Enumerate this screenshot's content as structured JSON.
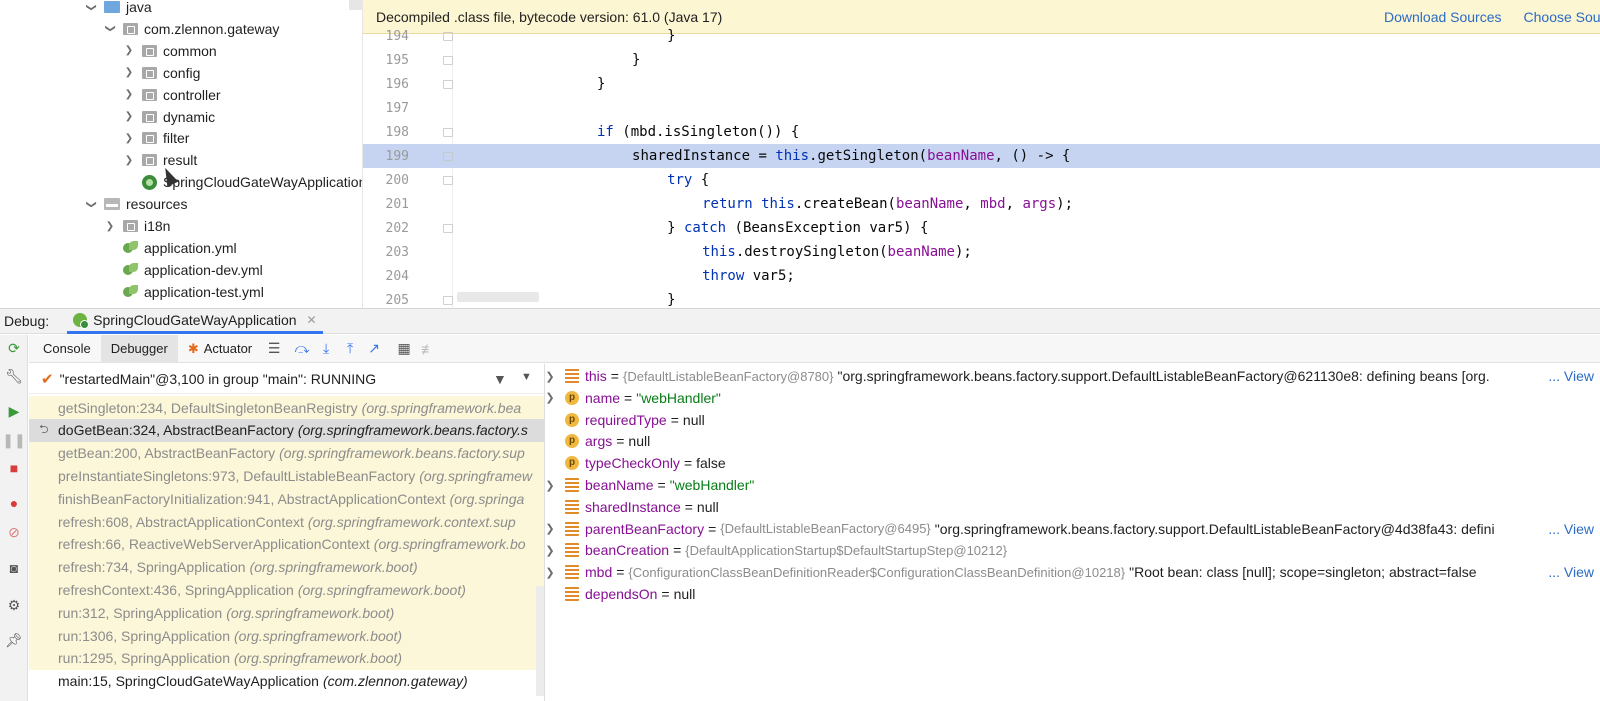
{
  "tree": {
    "items": [
      {
        "label": "java",
        "indent": 1,
        "chev": "down",
        "icon": "folder"
      },
      {
        "label": "com.zlennon.gateway",
        "indent": 2,
        "chev": "down",
        "icon": "package"
      },
      {
        "label": "common",
        "indent": 3,
        "chev": "right",
        "icon": "package"
      },
      {
        "label": "config",
        "indent": 3,
        "chev": "right",
        "icon": "package"
      },
      {
        "label": "controller",
        "indent": 3,
        "chev": "right",
        "icon": "package"
      },
      {
        "label": "dynamic",
        "indent": 3,
        "chev": "right",
        "icon": "package"
      },
      {
        "label": "filter",
        "indent": 3,
        "chev": "right",
        "icon": "package"
      },
      {
        "label": "result",
        "indent": 3,
        "chev": "right",
        "icon": "package"
      },
      {
        "label": "SpringCloudGateWayApplication",
        "indent": 3,
        "chev": "none",
        "icon": "class"
      },
      {
        "label": "resources",
        "indent": 1,
        "chev": "down",
        "icon": "resources"
      },
      {
        "label": "i18n",
        "indent": 2,
        "chev": "right",
        "icon": "package"
      },
      {
        "label": "application.yml",
        "indent": 2,
        "chev": "none",
        "icon": "yml"
      },
      {
        "label": "application-dev.yml",
        "indent": 2,
        "chev": "none",
        "icon": "yml"
      },
      {
        "label": "application-test.yml",
        "indent": 2,
        "chev": "none",
        "icon": "yml"
      }
    ]
  },
  "editor": {
    "banner": "Decompiled .class file, bytecode version: 61.0 (Java 17)",
    "download_sources": "Download Sources",
    "choose_sources": "Choose Sou",
    "lines": [
      {
        "num": "194",
        "indent": 8,
        "tokens": [
          [
            "t",
            "}"
          ]
        ],
        "fold": true
      },
      {
        "num": "195",
        "indent": 7,
        "tokens": [
          [
            "t",
            "}"
          ]
        ],
        "fold": true
      },
      {
        "num": "196",
        "indent": 6,
        "tokens": [
          [
            "t",
            "}"
          ]
        ],
        "fold": true
      },
      {
        "num": "197",
        "indent": 0,
        "tokens": [],
        "fold": false
      },
      {
        "num": "198",
        "indent": 6,
        "tokens": [
          [
            "k",
            "if"
          ],
          [
            "t",
            " (mbd.isSingleton()) {"
          ]
        ],
        "fold": true
      },
      {
        "num": "199",
        "indent": 7,
        "tokens": [
          [
            "t",
            "sharedInstance = "
          ],
          [
            "k",
            "this"
          ],
          [
            "t",
            ".getSingleton("
          ],
          [
            "p",
            "beanName"
          ],
          [
            "t",
            ", () -> {"
          ]
        ],
        "fold": true,
        "highlight": true
      },
      {
        "num": "200",
        "indent": 8,
        "tokens": [
          [
            "k",
            "try"
          ],
          [
            "t",
            " {"
          ]
        ],
        "fold": true
      },
      {
        "num": "201",
        "indent": 9,
        "tokens": [
          [
            "k",
            "return this"
          ],
          [
            "t",
            ".createBean("
          ],
          [
            "p",
            "beanName"
          ],
          [
            "t",
            ", "
          ],
          [
            "p",
            "mbd"
          ],
          [
            "t",
            ", "
          ],
          [
            "p",
            "args"
          ],
          [
            "t",
            ");"
          ]
        ],
        "fold": false
      },
      {
        "num": "202",
        "indent": 8,
        "tokens": [
          [
            "t",
            "} "
          ],
          [
            "k",
            "catch"
          ],
          [
            "t",
            " (BeansException var5) {"
          ]
        ],
        "fold": true
      },
      {
        "num": "203",
        "indent": 9,
        "tokens": [
          [
            "k",
            "this"
          ],
          [
            "t",
            ".destroySingleton("
          ],
          [
            "p",
            "beanName"
          ],
          [
            "t",
            ");"
          ]
        ],
        "fold": false
      },
      {
        "num": "204",
        "indent": 9,
        "tokens": [
          [
            "k",
            "throw"
          ],
          [
            "t",
            " var5;"
          ]
        ],
        "fold": false
      },
      {
        "num": "205",
        "indent": 8,
        "tokens": [
          [
            "t",
            "}"
          ]
        ],
        "fold": true
      }
    ]
  },
  "debug": {
    "label": "Debug:",
    "session_tab": "SpringCloudGateWayApplication",
    "tabs": [
      "Console",
      "Debugger",
      "Actuator"
    ],
    "thread": "\"restartedMain\"@3,100 in group \"main\": RUNNING",
    "frames": [
      {
        "method": "getSingleton:234, DefaultSingletonBeanRegistry",
        "pkg": "(org.springframework.bea",
        "state": "lib"
      },
      {
        "method": "doGetBean:324, AbstractBeanFactory",
        "pkg": "(org.springframework.beans.factory.s",
        "state": "current"
      },
      {
        "method": "getBean:200, AbstractBeanFactory",
        "pkg": "(org.springframework.beans.factory.sup",
        "state": "lib"
      },
      {
        "method": "preInstantiateSingletons:973, DefaultListableBeanFactory",
        "pkg": "(org.springframew",
        "state": "lib"
      },
      {
        "method": "finishBeanFactoryInitialization:941, AbstractApplicationContext",
        "pkg": "(org.springa",
        "state": "lib"
      },
      {
        "method": "refresh:608, AbstractApplicationContext",
        "pkg": "(org.springframework.context.sup",
        "state": "lib"
      },
      {
        "method": "refresh:66, ReactiveWebServerApplicationContext",
        "pkg": "(org.springframework.bo",
        "state": "lib"
      },
      {
        "method": "refresh:734, SpringApplication",
        "pkg": "(org.springframework.boot)",
        "state": "lib"
      },
      {
        "method": "refreshContext:436, SpringApplication",
        "pkg": "(org.springframework.boot)",
        "state": "lib"
      },
      {
        "method": "run:312, SpringApplication",
        "pkg": "(org.springframework.boot)",
        "state": "lib"
      },
      {
        "method": "run:1306, SpringApplication",
        "pkg": "(org.springframework.boot)",
        "state": "lib"
      },
      {
        "method": "run:1295, SpringApplication",
        "pkg": "(org.springframework.boot)",
        "state": "lib"
      },
      {
        "method": "main:15, SpringCloudGateWayApplication",
        "pkg": "(com.zlennon.gateway)",
        "state": "plain"
      }
    ],
    "variables": [
      {
        "expand": true,
        "kind": "field",
        "name": "this",
        "type": "{DefaultListableBeanFactory@8780}",
        "value": "\"org.springframework.beans.factory.support.DefaultListableBeanFactory@621130e8: defining beans [org.",
        "view": "... View"
      },
      {
        "expand": true,
        "kind": "param",
        "name": "name",
        "string": "\"webHandler\""
      },
      {
        "expand": false,
        "kind": "param",
        "name": "requiredType",
        "null": "null"
      },
      {
        "expand": false,
        "kind": "param",
        "name": "args",
        "null": "null"
      },
      {
        "expand": false,
        "kind": "param",
        "name": "typeCheckOnly",
        "null": "false"
      },
      {
        "expand": true,
        "kind": "field",
        "name": "beanName",
        "string": "\"webHandler\""
      },
      {
        "expand": false,
        "kind": "field",
        "name": "sharedInstance",
        "null": "null"
      },
      {
        "expand": true,
        "kind": "field",
        "name": "parentBeanFactory",
        "type": "{DefaultListableBeanFactory@6495}",
        "value": "\"org.springframework.beans.factory.support.DefaultListableBeanFactory@4d38fa43: defini",
        "view": "... View"
      },
      {
        "expand": true,
        "kind": "field",
        "name": "beanCreation",
        "type": "{DefaultApplicationStartup$DefaultStartupStep@10212}"
      },
      {
        "expand": true,
        "kind": "field",
        "name": "mbd",
        "type": "{ConfigurationClassBeanDefinitionReader$ConfigurationClassBeanDefinition@10218}",
        "value": "\"Root bean: class [null]; scope=singleton; abstract=false",
        "view": "... View"
      },
      {
        "expand": false,
        "kind": "field",
        "name": "dependsOn",
        "null": "null"
      }
    ]
  }
}
